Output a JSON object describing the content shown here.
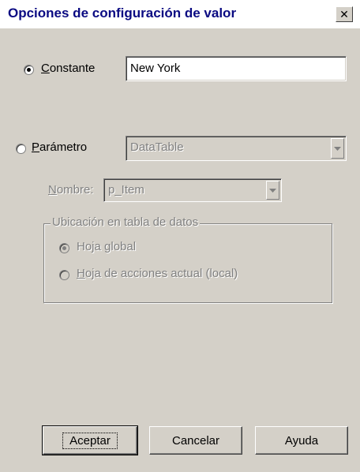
{
  "window": {
    "title": "Opciones de configuración de valor",
    "close_glyph": "✕"
  },
  "constant": {
    "label_underlined": "C",
    "label_rest": "onstante",
    "selected": true,
    "value": "New York"
  },
  "parameter": {
    "label_underlined": "P",
    "label_rest": "arámetro",
    "selected": false,
    "type_value": "DataTable",
    "name_label_underlined": "N",
    "name_label_rest": "ombre:",
    "name_value": "p_Item"
  },
  "location_group": {
    "legend": "Ubicación en tabla de datos",
    "option_global_pre": "Hoja ",
    "option_global_underlined": "g",
    "option_global_post": "lobal",
    "option_global_selected": true,
    "option_local_underlined": "H",
    "option_local_rest": "oja de acciones actual (local)",
    "option_local_selected": false
  },
  "buttons": {
    "ok": "Aceptar",
    "cancel": "Cancelar",
    "help": "Ayuda"
  },
  "icons": {
    "dropdown": "chevron-down-icon",
    "close": "close-icon"
  }
}
